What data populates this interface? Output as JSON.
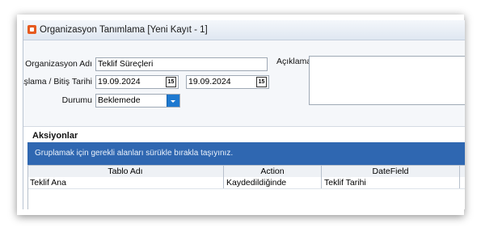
{
  "window": {
    "title": "Organizasyon Tanımlama [Yeni Kayıt - 1]"
  },
  "form": {
    "org_name_label": "Organizasyon Adı",
    "org_name_value": "Teklif Süreçleri",
    "date_label": "Başlama / Bitiş Tarihi",
    "start_date": "19.09.2024",
    "end_date": "19.09.2024",
    "status_label": "Durumu",
    "status_value": "Beklemede",
    "description_label": "Açıklama",
    "calendar_icon_text": "15"
  },
  "actions": {
    "title": "Aksiyonlar",
    "group_hint": "Gruplamak için gerekli alanları sürükle bırakla taşıyınız.",
    "columns": [
      "Tablo Adı",
      "Action",
      "DateField"
    ],
    "rows": [
      [
        "Teklif Ana",
        "Kaydedildiğinde",
        "Teklif Tarihi"
      ]
    ]
  },
  "colors": {
    "accent": "#1e79d0",
    "group_bar": "#2f67b1",
    "app_icon": "#e65a1f"
  }
}
